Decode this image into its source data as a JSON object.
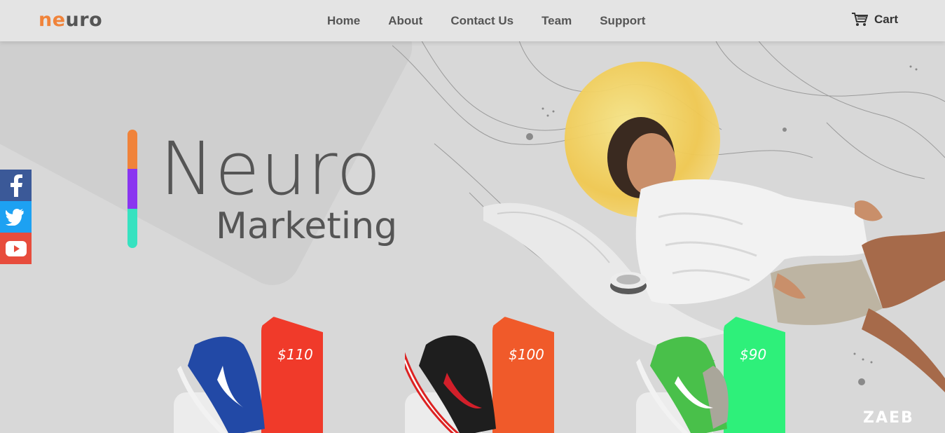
{
  "header": {
    "logo_part1": "ne",
    "logo_part2": "uro",
    "nav": [
      "Home",
      "About",
      "Contact Us",
      "Team",
      "Support"
    ],
    "cart_label": "Cart"
  },
  "hero": {
    "title": "Neuro",
    "subtitle": "Marketing",
    "bar_colors": [
      "#f0833a",
      "#8a35f0",
      "#36e2c0"
    ]
  },
  "social": [
    "facebook-icon",
    "twitter-icon",
    "youtube-icon"
  ],
  "products": [
    {
      "price": "$110",
      "tag_color": "#f03a2a",
      "shoe_color": "#2249a6"
    },
    {
      "price": "$100",
      "tag_color": "#f05a2a",
      "shoe_color": "#1e1e1e"
    },
    {
      "price": "$90",
      "tag_color": "#2ef07a",
      "shoe_color": "#49c04a"
    }
  ],
  "watermark": "ZAEB"
}
